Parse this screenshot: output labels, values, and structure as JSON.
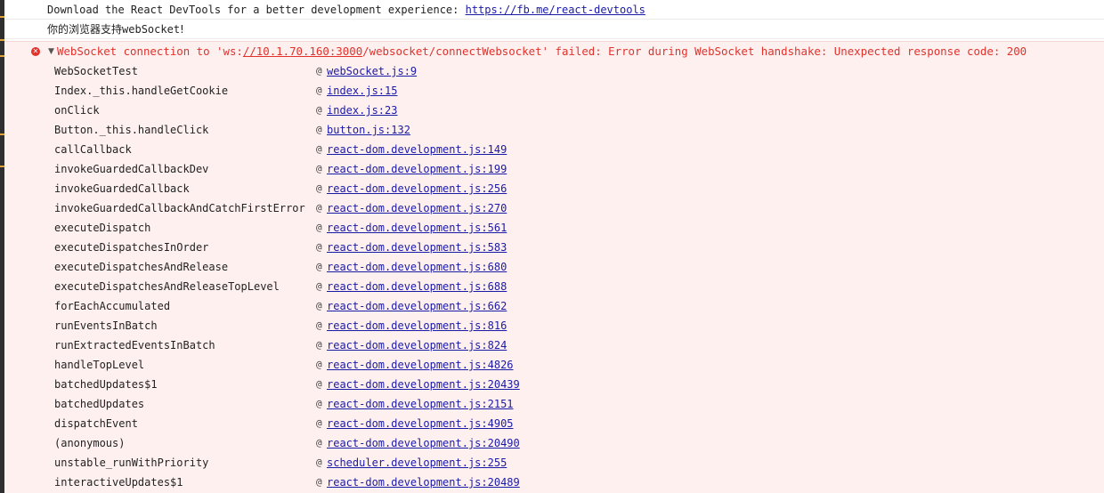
{
  "gutter_color": "#2f2f2f",
  "error_color": "#e0322b",
  "link_color": "#1a1aa6",
  "messages": {
    "devtools_text": "Download the React DevTools for a better development experience: ",
    "devtools_link": "https://fb.me/react-devtools",
    "support_cjk": "你的浏览器支持",
    "support_ascii": "webSocket",
    "support_end": "!"
  },
  "error": {
    "icon": "error-circle-icon",
    "caret": "▼",
    "prefix": "WebSocket connection to 'ws:",
    "url": "//10.1.70.160:3000",
    "suffix": "/websocket/connectWebsocket' failed: Error during WebSocket handshake: Unexpected response code: 200"
  },
  "stack": [
    {
      "fn": "WebSocketTest",
      "loc": "webSocket.js:9"
    },
    {
      "fn": "Index._this.handleGetCookie",
      "loc": "index.js:15"
    },
    {
      "fn": "onClick",
      "loc": "index.js:23"
    },
    {
      "fn": "Button._this.handleClick",
      "loc": "button.js:132"
    },
    {
      "fn": "callCallback",
      "loc": "react-dom.development.js:149"
    },
    {
      "fn": "invokeGuardedCallbackDev",
      "loc": "react-dom.development.js:199"
    },
    {
      "fn": "invokeGuardedCallback",
      "loc": "react-dom.development.js:256"
    },
    {
      "fn": "invokeGuardedCallbackAndCatchFirstError",
      "loc": "react-dom.development.js:270"
    },
    {
      "fn": "executeDispatch",
      "loc": "react-dom.development.js:561"
    },
    {
      "fn": "executeDispatchesInOrder",
      "loc": "react-dom.development.js:583"
    },
    {
      "fn": "executeDispatchesAndRelease",
      "loc": "react-dom.development.js:680"
    },
    {
      "fn": "executeDispatchesAndReleaseTopLevel",
      "loc": "react-dom.development.js:688"
    },
    {
      "fn": "forEachAccumulated",
      "loc": "react-dom.development.js:662"
    },
    {
      "fn": "runEventsInBatch",
      "loc": "react-dom.development.js:816"
    },
    {
      "fn": "runExtractedEventsInBatch",
      "loc": "react-dom.development.js:824"
    },
    {
      "fn": "handleTopLevel",
      "loc": "react-dom.development.js:4826"
    },
    {
      "fn": "batchedUpdates$1",
      "loc": "react-dom.development.js:20439"
    },
    {
      "fn": "batchedUpdates",
      "loc": "react-dom.development.js:2151"
    },
    {
      "fn": "dispatchEvent",
      "loc": "react-dom.development.js:4905"
    },
    {
      "fn": "(anonymous)",
      "loc": "react-dom.development.js:20490"
    },
    {
      "fn": "unstable_runWithPriority",
      "loc": "scheduler.development.js:255"
    },
    {
      "fn": "interactiveUpdates$1",
      "loc": "react-dom.development.js:20489"
    }
  ]
}
